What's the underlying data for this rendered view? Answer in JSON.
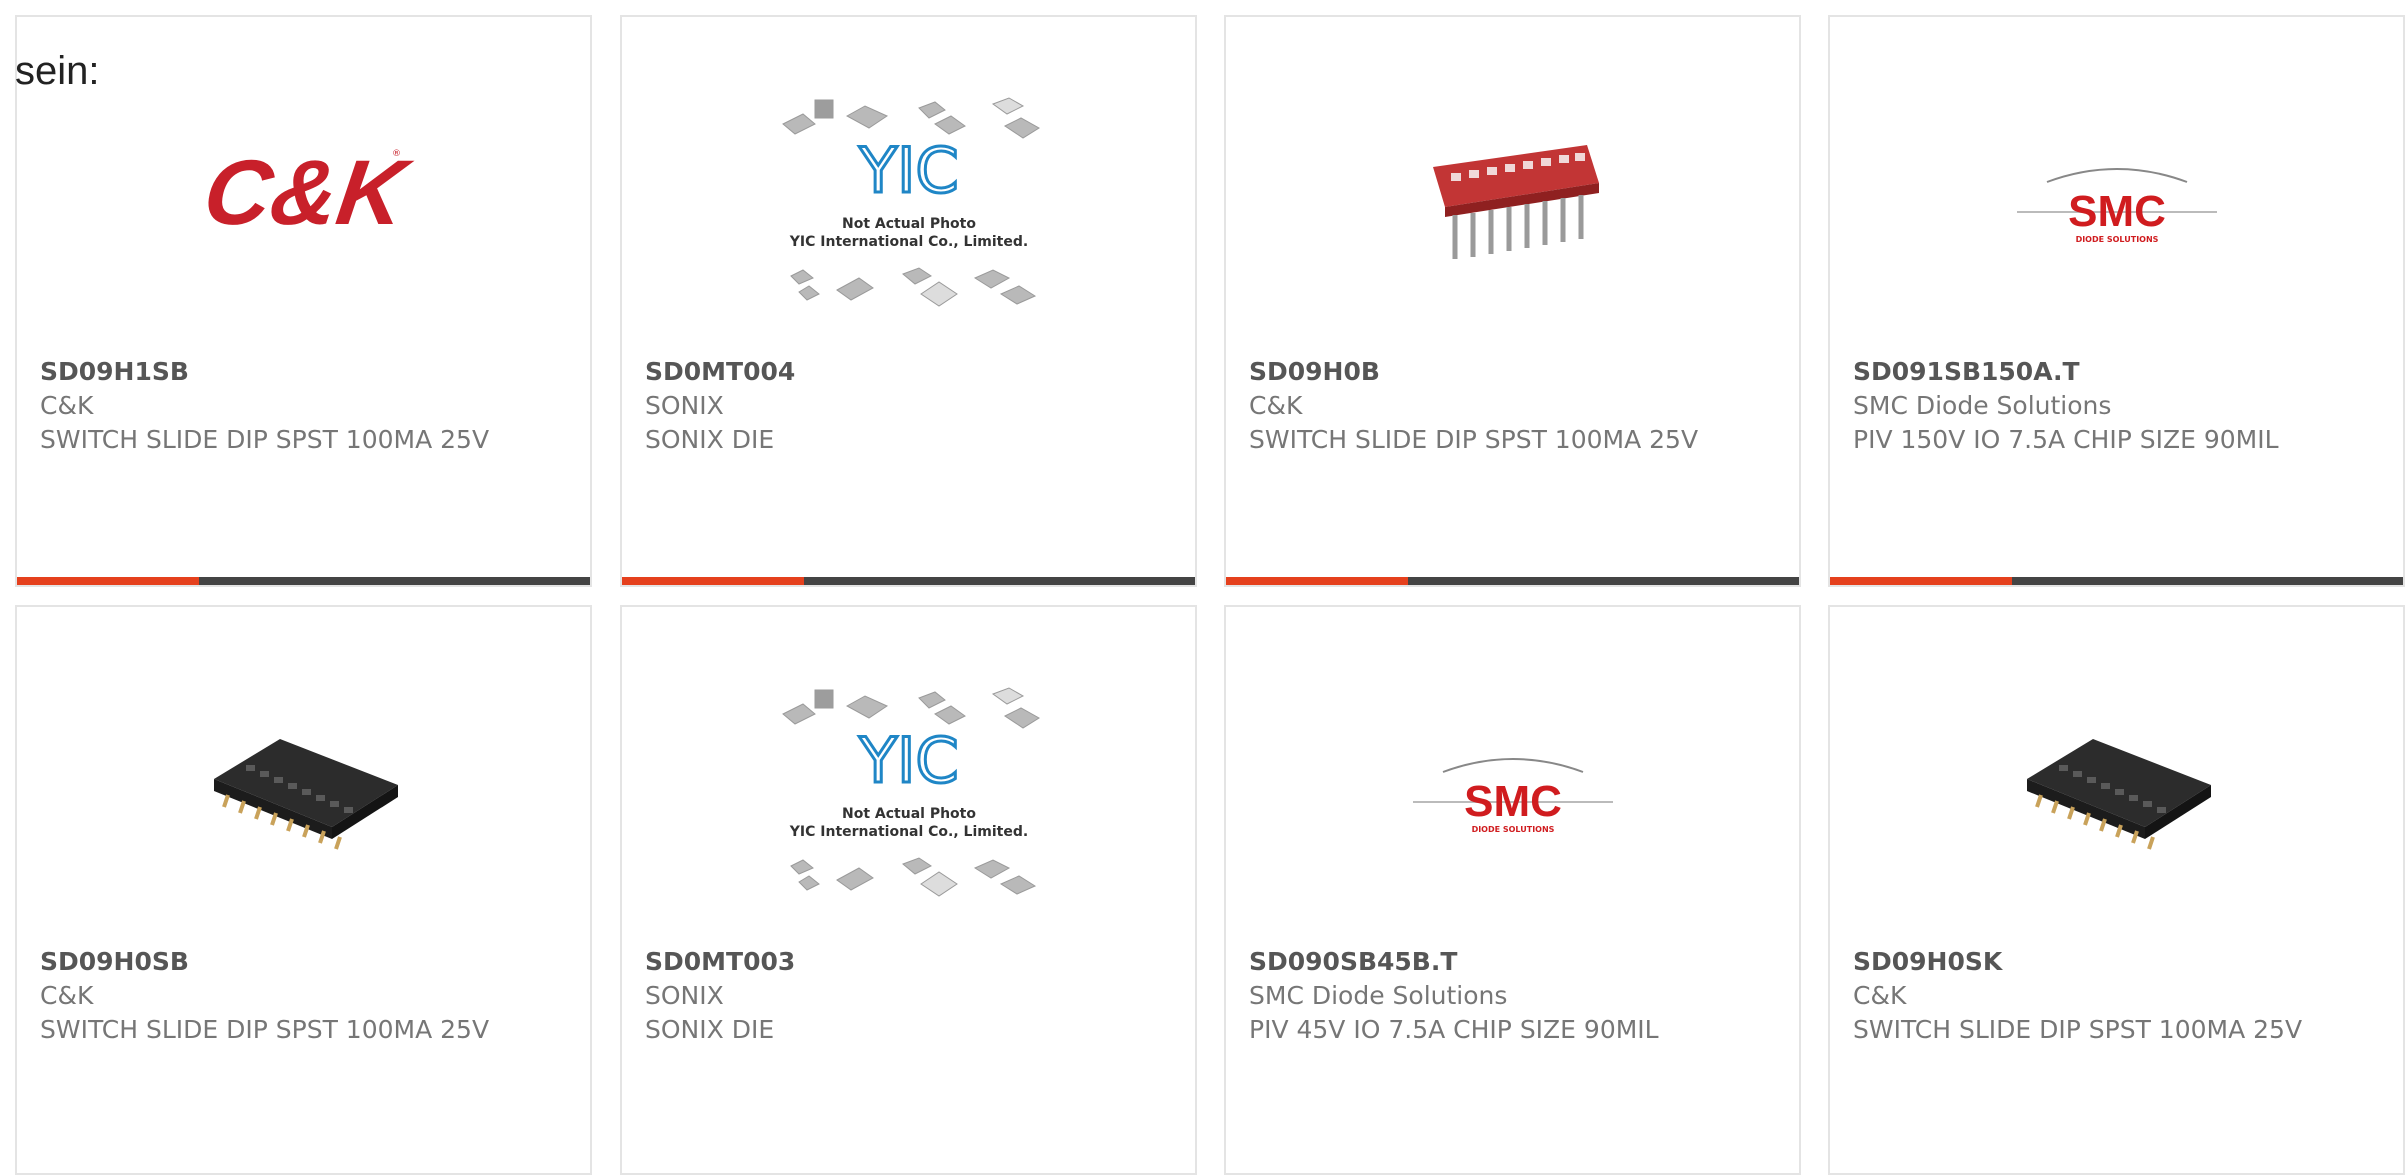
{
  "lead_text": "sein:",
  "colors": {
    "accent": "#e5401d",
    "bar_dark": "#444444",
    "part_number": "#565656",
    "text": "#767676",
    "card_border": "#e4e4e4",
    "ck_red": "#c8202a",
    "smc_red": "#d01c1f",
    "yic_blue": "#1f86c6"
  },
  "products": [
    {
      "part_number": "SD09H1SB",
      "manufacturer": "C&K",
      "description": "SWITCH SLIDE DIP SPST 100MA 25V",
      "image": "ck-logo"
    },
    {
      "part_number": "SD0MT004",
      "manufacturer": "SONIX",
      "description": "SONIX DIE",
      "image": "yic-placeholder",
      "image_text": {
        "brand": "YIC",
        "line1": "Not Actual Photo",
        "line2": "YIC International Co., Limited."
      }
    },
    {
      "part_number": "SD09H0B",
      "manufacturer": "C&K",
      "description": "SWITCH SLIDE DIP SPST 100MA 25V",
      "image": "red-dip-switch"
    },
    {
      "part_number": "SD091SB150A.T",
      "manufacturer": "SMC Diode Solutions",
      "description": "PIV 150V IO 7.5A CHIP SIZE 90MIL",
      "image": "smc-logo",
      "image_text": {
        "brand": "SMC",
        "tagline": "DIODE SOLUTIONS"
      }
    },
    {
      "part_number": "SD09H0SB",
      "manufacturer": "C&K",
      "description": "SWITCH SLIDE DIP SPST 100MA 25V",
      "image": "black-dip-switch"
    },
    {
      "part_number": "SD0MT003",
      "manufacturer": "SONIX",
      "description": "SONIX DIE",
      "image": "yic-placeholder",
      "image_text": {
        "brand": "YIC",
        "line1": "Not Actual Photo",
        "line2": "YIC International Co., Limited."
      }
    },
    {
      "part_number": "SD090SB45B.T",
      "manufacturer": "SMC Diode Solutions",
      "description": "PIV 45V IO 7.5A CHIP SIZE 90MIL",
      "image": "smc-logo",
      "image_text": {
        "brand": "SMC",
        "tagline": "DIODE SOLUTIONS"
      }
    },
    {
      "part_number": "SD09H0SK",
      "manufacturer": "C&K",
      "description": "SWITCH SLIDE DIP SPST 100MA 25V",
      "image": "black-dip-switch"
    }
  ]
}
